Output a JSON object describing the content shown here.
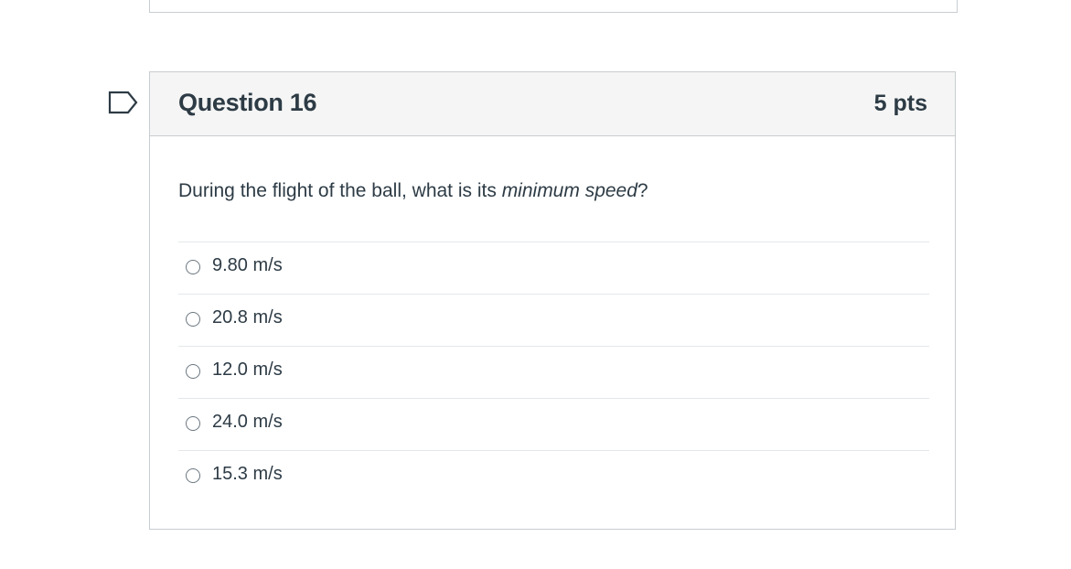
{
  "question": {
    "title": "Question 16",
    "points": "5 pts",
    "text_before": "During the flight of the ball, what is its ",
    "text_emphasis": "minimum speed",
    "text_after": "?",
    "flag_icon": "flag-outline-icon",
    "answers": [
      {
        "label": "9.80 m/s",
        "selected": false
      },
      {
        "label": "20.8 m/s",
        "selected": false
      },
      {
        "label": "12.0 m/s",
        "selected": false
      },
      {
        "label": "24.0 m/s",
        "selected": false
      },
      {
        "label": "15.3 m/s",
        "selected": false
      }
    ]
  },
  "colors": {
    "text": "#2d3b45",
    "border": "#c7cdd1",
    "header_bg": "#f5f5f5",
    "divider": "#e4e7ea"
  }
}
